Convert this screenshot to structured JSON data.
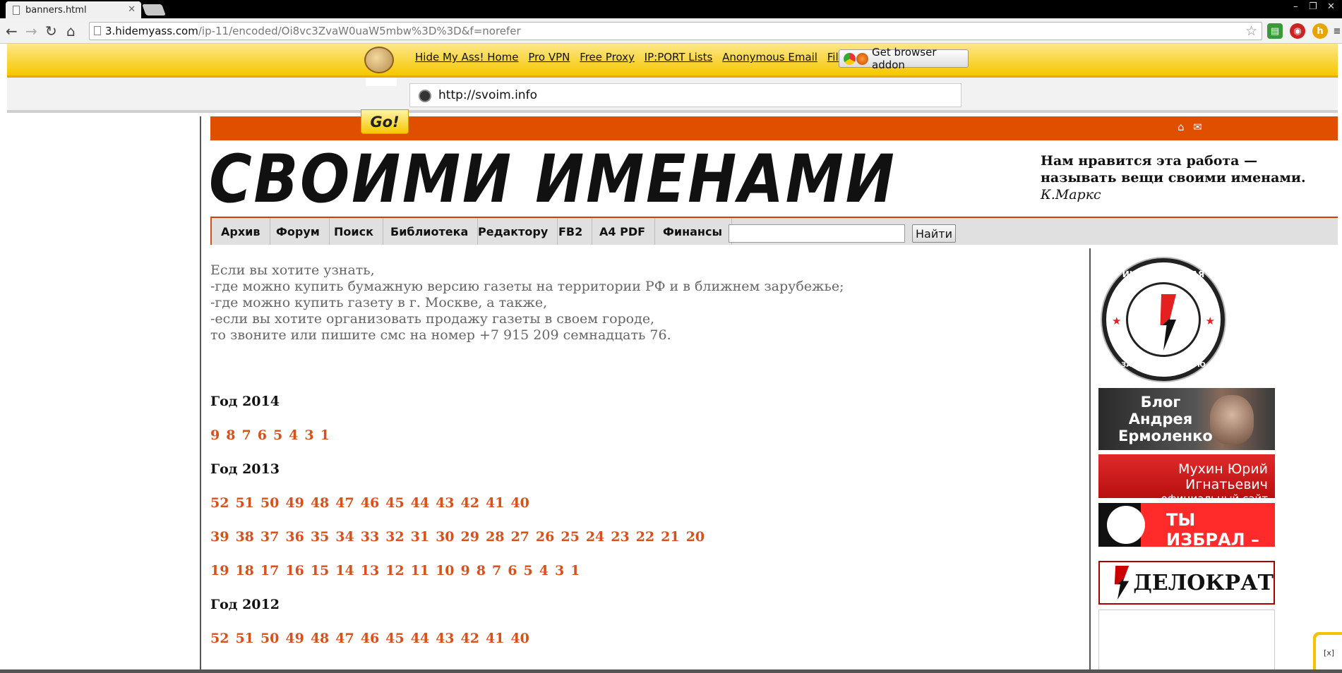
{
  "browser": {
    "tab_title": "banners.html",
    "url_host": "3.hidemyass.com",
    "url_path": "/ip-11/encoded/Oi8vc3ZvaW0uaW5mbw%3D%3D&f=norefer"
  },
  "hma": {
    "links": [
      "Hide My Ass! Home",
      "Pro VPN",
      "Free Proxy",
      "IP:PORT Lists",
      "Anonymous Email",
      "File Upload"
    ],
    "addon_label": "Get browser addon",
    "url_value": "http://svoim.info",
    "go_label": "Go!"
  },
  "site": {
    "logo": "СВОИМИ  ИМЕНАМИ",
    "quote_line1": "Нам нравится эта работа —",
    "quote_line2": "называть вещи своими именами.",
    "quote_author": "К.Маркс",
    "menu": [
      "Архив",
      "Форум",
      "Поиск",
      "Библиотека",
      "Редактору",
      "FB2",
      "A4 PDF",
      "Финансы"
    ],
    "search_button": "Найти"
  },
  "intro": [
    "Если вы хотите узнать,",
    "-где можно купить бумажную версию газеты на территории РФ и в ближнем зарубежье;",
    "-где можно купить газету в г. Москве, а также,",
    "-если вы хотите организовать продажу газеты в своем городе,",
    "то звоните или пишите смс на номер +7 915 209 семнадцать 76."
  ],
  "archive": {
    "y2014": {
      "label": "Год 2014",
      "rows": [
        [
          "9",
          "8",
          "7",
          "6",
          "5",
          "4",
          "3",
          "1"
        ]
      ]
    },
    "y2013": {
      "label": "Год 2013",
      "rows": [
        [
          "52",
          "51",
          "50",
          "49",
          "48",
          "47",
          "46",
          "45",
          "44",
          "43",
          "42",
          "41",
          "40"
        ],
        [
          "39",
          "38",
          "37",
          "36",
          "35",
          "34",
          "33",
          "32",
          "31",
          "30",
          "29",
          "28",
          "27",
          "26",
          "25",
          "24",
          "23",
          "22",
          "21",
          "20"
        ],
        [
          "19",
          "18",
          "17",
          "16",
          "15",
          "14",
          "13",
          "12",
          "11",
          "10",
          "9",
          "8",
          "7",
          "6",
          "5",
          "4",
          "3",
          "1"
        ]
      ]
    },
    "y2012": {
      "label": "Год 2012",
      "rows": [
        [
          "52",
          "51",
          "50",
          "49",
          "48",
          "47",
          "46",
          "45",
          "44",
          "43",
          "42",
          "41",
          "40"
        ]
      ]
    }
  },
  "sidebar": {
    "badge_top": "ИНИЦИАТИВНАЯ ГРУППА",
    "badge_bottom": "ЗА ОТВЕТСТВЕННУЮ ВЛАСТЬ",
    "blog": "Блог Андрея Ермоленко",
    "mukhin_line1": "Мухин Юрий Игнатьевич",
    "mukhin_line2": "официальный сайт",
    "izbral": "ТЫ ИЗБРАЛ –",
    "delokrat": "ДЕЛОКРАТ",
    "corner_close": "[x]"
  },
  "colors": {
    "accent_orange": "#e04e00",
    "link_red": "#d8501a",
    "hma_yellow": "#f6c700"
  }
}
